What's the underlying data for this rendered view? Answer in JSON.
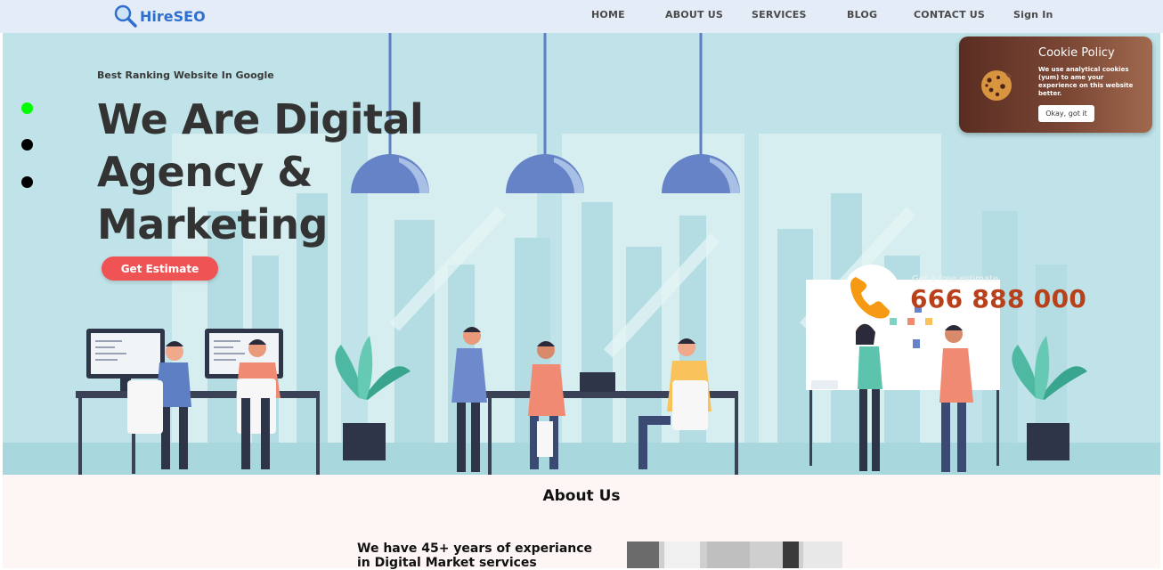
{
  "brand": {
    "name": "HireSEO",
    "icon": "magnifier-icon",
    "color": "#2f6fcf"
  },
  "nav": {
    "items": [
      {
        "label": "HOME"
      },
      {
        "label": "ABOUT US"
      },
      {
        "label": "SERVICES"
      },
      {
        "label": "BLOG"
      },
      {
        "label": "CONTACT US"
      }
    ],
    "sign_in": "Sign In"
  },
  "hero": {
    "tagline": "Best Ranking Website In Google",
    "headline_lines": [
      "We Are Digital",
      "Agency &",
      "Marketing"
    ],
    "cta": "Get Estimate",
    "cta_color": "#ef5354",
    "slider_dots": [
      {
        "active": true,
        "color": "#00ff00"
      },
      {
        "active": false,
        "color": "#000000"
      },
      {
        "active": false,
        "color": "#000000"
      }
    ],
    "estimate_label": "Get a free estimate",
    "phone": "666 888 000",
    "phone_icon": "phone-icon",
    "illustration": "office-team-illustration"
  },
  "cookie": {
    "title": "Cookie Policy",
    "text": "We use analytical cookies (yum) to ame your experience on this website better.",
    "button": "Okay, got it",
    "icon": "cookie-icon"
  },
  "about": {
    "title": "About Us",
    "text": "We have 45+ years of experiance in Digital Market services"
  }
}
